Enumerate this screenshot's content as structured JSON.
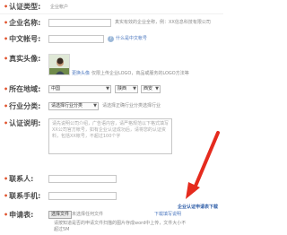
{
  "form": {
    "auth_type": {
      "label": "认证类型:",
      "value": "企业帐户"
    },
    "company_name": {
      "label": "企业名称:",
      "input_value": "",
      "hint": "真实有效的企业全称，例：XX信息科技有限公司"
    },
    "chinese_account": {
      "label": "中文帐号:",
      "input_value": "",
      "hint": "什么是中文帐号"
    },
    "avatar": {
      "label": "真实头像:",
      "caption": "更换头像",
      "hint": "仅限上传企业LOGO，商品或服务的LOGO方法等"
    },
    "region": {
      "label": "所在地域:",
      "country": "中国",
      "province": "陕西",
      "city": "西安"
    },
    "industry": {
      "label": "行业分类:",
      "select": "请选择行业分类",
      "hint": "请选择正确行业分类选择行业"
    },
    "description": {
      "label": "认证说明:",
      "placeholder": "请先说明公司介绍，广告语内容，请严格规范以下格式填写XX公司官方帐号，如有企业认证成功后，请将您的认证资料，包括XX帐号，不超过100个字"
    },
    "contact_person": {
      "label": "联系人:",
      "input_value": ""
    },
    "contact_phone": {
      "label": "联系手机:",
      "input_value": ""
    },
    "application": {
      "label": "申请表:",
      "choose_file_button": "选择文件",
      "file_status": "未选择任何文件",
      "link_template": "下载填写说明",
      "link_download": "企业认证申请表下载"
    },
    "footer_hint": "请按知道是否的申请文件扫描的图片存成word中上传，文件大小不超过5M"
  }
}
